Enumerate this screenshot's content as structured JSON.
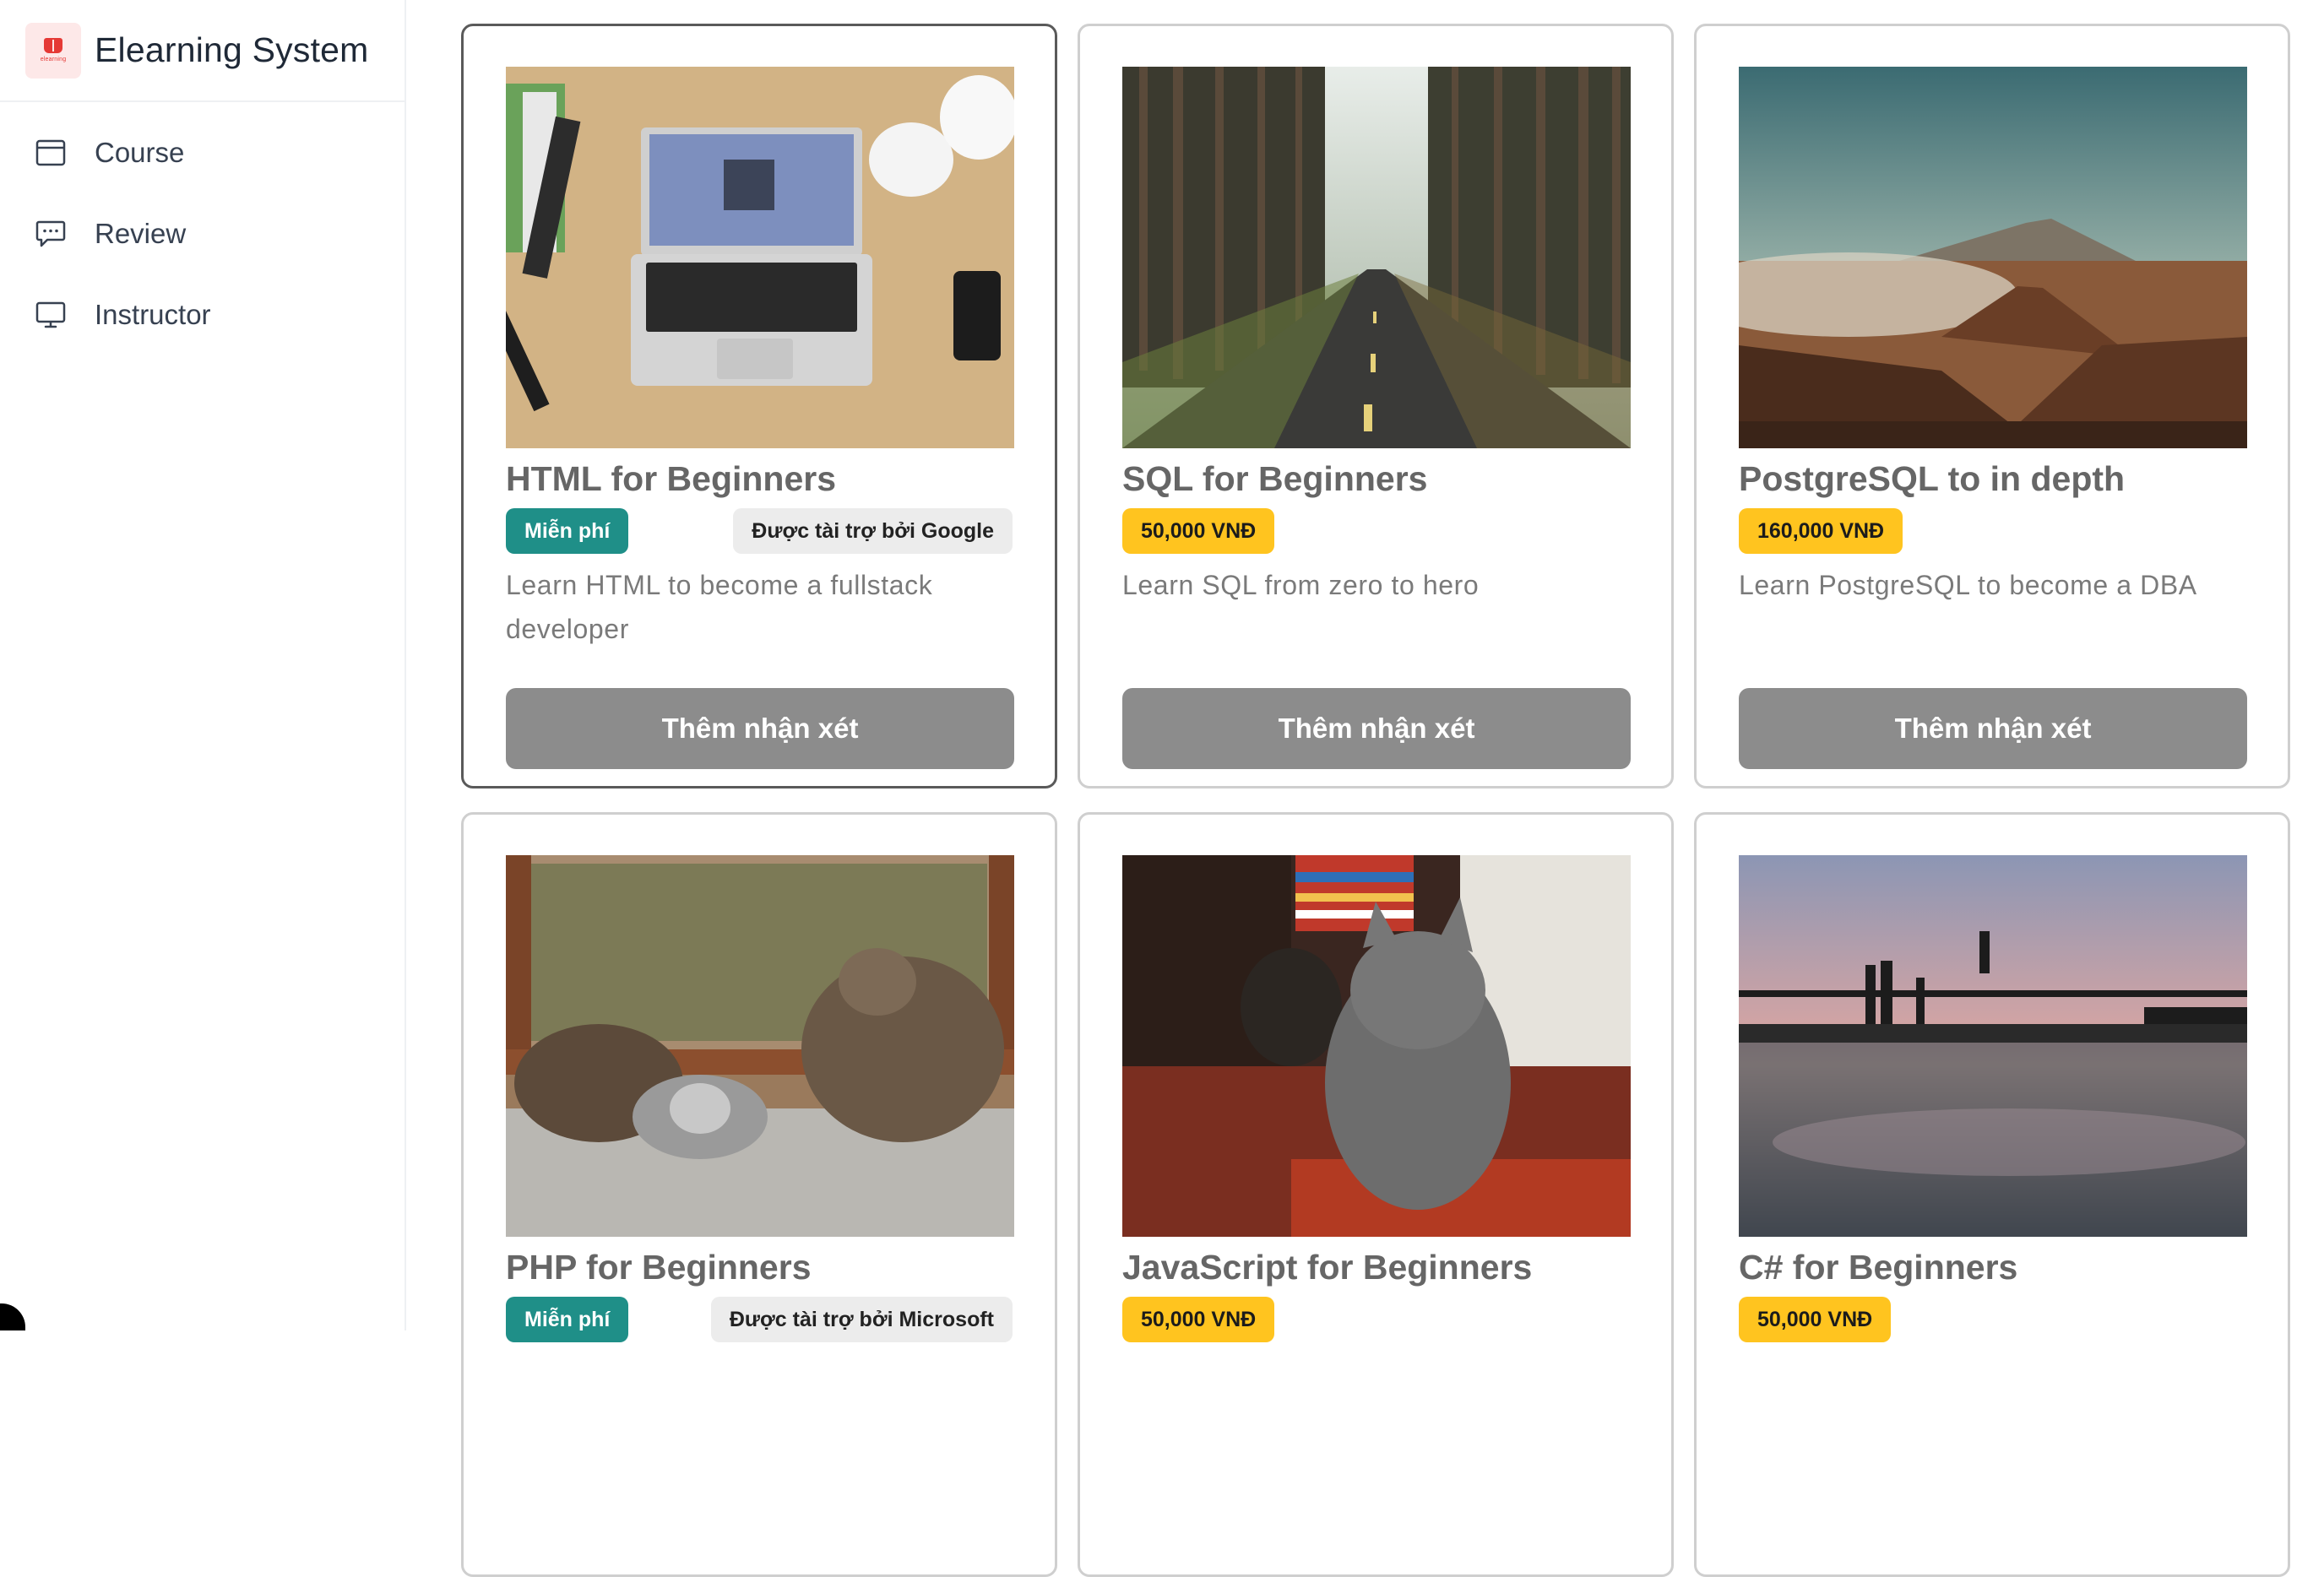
{
  "app": {
    "title": "Elearning System",
    "logo_text": "elearning"
  },
  "sidebar": {
    "items": [
      {
        "label": "Course",
        "icon": "browser-window-icon"
      },
      {
        "label": "Review",
        "icon": "chat-bubble-icon"
      },
      {
        "label": "Instructor",
        "icon": "monitor-icon"
      }
    ]
  },
  "courses": [
    {
      "title": "HTML for Beginners",
      "price": "Miễn phí",
      "price_type": "free",
      "sponsor": "Được tài trợ bởi Google",
      "description": "Learn HTML to become a fullstack developer",
      "button": "Thêm nhận xét",
      "image": "laptop-on-desk"
    },
    {
      "title": "SQL for Beginners",
      "price": "50,000 VNĐ",
      "price_type": "paid",
      "sponsor": "",
      "description": "Learn SQL from zero to hero",
      "button": "Thêm nhận xét",
      "image": "forest-road"
    },
    {
      "title": "PostgreSQL to in depth",
      "price": "160,000 VNĐ",
      "price_type": "paid",
      "sponsor": "",
      "description": "Learn PostgreSQL to become a DBA",
      "button": "Thêm nhận xét",
      "image": "volcano-landscape"
    },
    {
      "title": "PHP for Beginners",
      "price": "Miễn phí",
      "price_type": "free",
      "sponsor": "Được tài trợ bởi Microsoft",
      "description": "",
      "button": "",
      "image": "cats-by-window"
    },
    {
      "title": "JavaScript for Beginners",
      "price": "50,000 VNĐ",
      "price_type": "paid",
      "sponsor": "",
      "description": "",
      "button": "",
      "image": "grey-kitten"
    },
    {
      "title": "C# for Beginners",
      "price": "50,000 VNĐ",
      "price_type": "paid",
      "sponsor": "",
      "description": "",
      "button": "",
      "image": "people-jumping-at-sunset"
    }
  ],
  "colors": {
    "free_badge": "#1f8f88",
    "price_badge": "#ffc41f",
    "sponsor_badge": "#ececec",
    "review_button": "#8c8c8c",
    "selected_border": "#5a5a5a",
    "card_border": "#cfcfcf"
  }
}
